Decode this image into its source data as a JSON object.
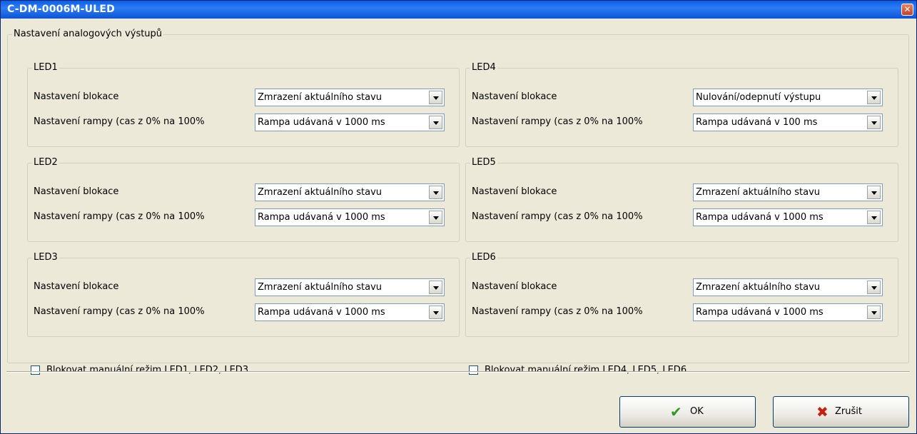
{
  "window": {
    "title": "C-DM-0006M-ULED",
    "close_glyph": "✕"
  },
  "main_group": {
    "legend": "Nastavení analogových výstupů"
  },
  "led_groups": [
    {
      "legend": "LED1",
      "block_label": "Nastavení blokace",
      "block_value": "Zmrazení aktuálního stavu",
      "ramp_label": "Nastavení rampy (cas z 0% na 100%",
      "ramp_value": "Rampa udávaná v 1000 ms"
    },
    {
      "legend": "LED2",
      "block_label": "Nastavení blokace",
      "block_value": "Zmrazení aktuálního stavu",
      "ramp_label": "Nastavení rampy (cas z 0% na 100%",
      "ramp_value": "Rampa udávaná v 1000 ms"
    },
    {
      "legend": "LED3",
      "block_label": "Nastavení blokace",
      "block_value": "Zmrazení aktuálního stavu",
      "ramp_label": "Nastavení rampy (cas z 0% na 100%",
      "ramp_value": "Rampa udávaná v 1000 ms"
    },
    {
      "legend": "LED4",
      "block_label": "Nastavení blokace",
      "block_value": "Nulování/odepnutí výstupu",
      "ramp_label": "Nastavení rampy (cas z 0% na 100%",
      "ramp_value": "Rampa udávaná v 100 ms"
    },
    {
      "legend": "LED5",
      "block_label": "Nastavení blokace",
      "block_value": "Zmrazení aktuálního stavu",
      "ramp_label": "Nastavení rampy (cas z 0% na 100%",
      "ramp_value": "Rampa udávaná v 1000 ms"
    },
    {
      "legend": "LED6",
      "block_label": "Nastavení blokace",
      "block_value": "Zmrazení aktuálního stavu",
      "ramp_label": "Nastavení rampy (cas z 0% na 100%",
      "ramp_value": "Rampa udávaná v 1000 ms"
    }
  ],
  "checkboxes": [
    {
      "label": "Blokovat manuální režim LED1, LED2, LED3",
      "checked": false
    },
    {
      "label": "Blokovat manuální režim LED4, LED5, LED6",
      "checked": false
    }
  ],
  "buttons": {
    "ok": {
      "label": "OK",
      "icon": "checkmark-icon",
      "icon_color": "#2E9A1E"
    },
    "cancel": {
      "label": "Zrušit",
      "icon": "cross-icon",
      "icon_color": "#C8200E"
    }
  },
  "colors": {
    "titlebar": "#0A5FE8",
    "dialog_bg": "#ECE9D8",
    "close_button": "#D1512F"
  }
}
